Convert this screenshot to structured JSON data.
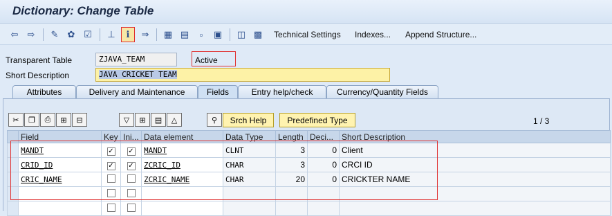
{
  "window": {
    "title": "Dictionary: Change Table"
  },
  "toolbar": {
    "technical_settings": "Technical Settings",
    "indexes": "Indexes...",
    "append_structure": "Append Structure..."
  },
  "header": {
    "table_label": "Transparent Table",
    "table_value": "ZJAVA_TEAM",
    "status": "Active",
    "short_desc_label": "Short Description",
    "short_desc_value": "JAVA CRICKET TEAM"
  },
  "tabs": [
    {
      "label": "Attributes"
    },
    {
      "label": "Delivery and Maintenance"
    },
    {
      "label": "Fields"
    },
    {
      "label": "Entry help/check"
    },
    {
      "label": "Currency/Quantity Fields"
    }
  ],
  "fields_toolbar": {
    "srch_help": "Srch Help",
    "predefined_type": "Predefined Type",
    "page_indicator": "1 / 3"
  },
  "grid": {
    "columns": [
      "Field",
      "Key",
      "Ini...",
      "Data element",
      "Data Type",
      "Length",
      "Deci...",
      "Short Description"
    ],
    "rows": [
      {
        "field": "MANDT",
        "key": true,
        "initial": true,
        "data_element": "MANDT",
        "data_type": "CLNT",
        "length": "3",
        "decimals": "0",
        "description": "Client"
      },
      {
        "field": "CRID_ID",
        "key": true,
        "initial": true,
        "data_element": "ZCRIC_ID",
        "data_type": "CHAR",
        "length": "3",
        "decimals": "0",
        "description": "CRCI ID"
      },
      {
        "field": "CRIC_NAME",
        "key": false,
        "initial": false,
        "data_element": "ZCRIC_NAME",
        "data_type": "CHAR",
        "length": "20",
        "decimals": "0",
        "description": "CRICKTER NAME"
      },
      {
        "field": "",
        "key": false,
        "initial": false,
        "data_element": "",
        "data_type": "",
        "length": "",
        "decimals": "",
        "description": ""
      },
      {
        "field": "",
        "key": false,
        "initial": false,
        "data_element": "",
        "data_type": "",
        "length": "",
        "decimals": "",
        "description": ""
      }
    ]
  },
  "colors": {
    "highlight": "#e03030",
    "panel_bg": "#dde8f5",
    "yellow_button": "#fff3b0",
    "short_desc_bg": "#fdf2a6"
  }
}
